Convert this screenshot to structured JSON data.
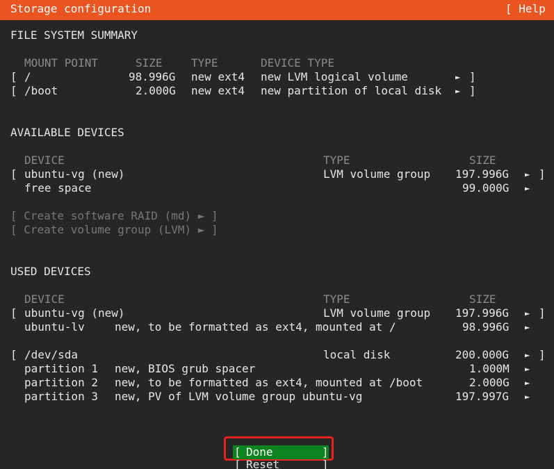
{
  "header": {
    "title": "Storage configuration",
    "help": "[ Help ]"
  },
  "fs_summary": {
    "heading": "FILE SYSTEM SUMMARY",
    "columns": {
      "mount": "MOUNT POINT",
      "size": "SIZE",
      "type": "TYPE",
      "device_type": "DEVICE TYPE"
    },
    "rows": [
      {
        "bracket": "[",
        "mount": "/",
        "size": "98.996G",
        "type": "new ext4",
        "device_type": "new LVM logical volume",
        "arrow": "►",
        "close": "]"
      },
      {
        "bracket": "[",
        "mount": "/boot",
        "size": "2.000G",
        "type": "new ext4",
        "device_type": "new partition of local disk",
        "arrow": "►",
        "close": "]"
      }
    ]
  },
  "available": {
    "heading": "AVAILABLE DEVICES",
    "columns": {
      "device": "DEVICE",
      "type": "TYPE",
      "size": "SIZE"
    },
    "vg": {
      "bracket": "[",
      "name": "ubuntu-vg (new)",
      "type": "LVM volume group",
      "size": "197.996G",
      "arrow": "►",
      "close": "]"
    },
    "free": {
      "name": "free space",
      "size": "99.000G",
      "arrow": "►"
    },
    "actions": [
      "[ Create software RAID (md) ► ]",
      "[ Create volume group (LVM) ► ]"
    ]
  },
  "used": {
    "heading": "USED DEVICES",
    "columns": {
      "device": "DEVICE",
      "type": "TYPE",
      "size": "SIZE"
    },
    "vg": {
      "bracket": "[",
      "name": "ubuntu-vg (new)",
      "type": "LVM volume group",
      "size": "197.996G",
      "arrow": "►",
      "close": "]"
    },
    "lv": {
      "name": "ubuntu-lv",
      "desc": "new, to be formatted as ext4, mounted at /",
      "size": "98.996G",
      "arrow": "►"
    },
    "disk": {
      "bracket": "[",
      "name": "/dev/sda",
      "type": "local disk",
      "size": "200.000G",
      "arrow": "►",
      "close": "]"
    },
    "partitions": [
      {
        "name": "partition 1",
        "desc": "new, BIOS grub spacer",
        "size": "1.000M",
        "arrow": "►"
      },
      {
        "name": "partition 2",
        "desc": "new, to be formatted as ext4, mounted at /boot",
        "size": "2.000G",
        "arrow": "►"
      },
      {
        "name": "partition 3",
        "desc": "new, PV of LVM volume group ubuntu-vg",
        "size": "197.997G",
        "arrow": "►"
      }
    ]
  },
  "buttons": {
    "done_open": "[",
    "done": "Done",
    "done_close": "]",
    "reset_open": "[",
    "reset": "Reset",
    "reset_close": "]"
  },
  "colors": {
    "header": "#e95420",
    "done_bg": "#0e8420",
    "highlight": "#e5231f",
    "background": "#262626"
  }
}
